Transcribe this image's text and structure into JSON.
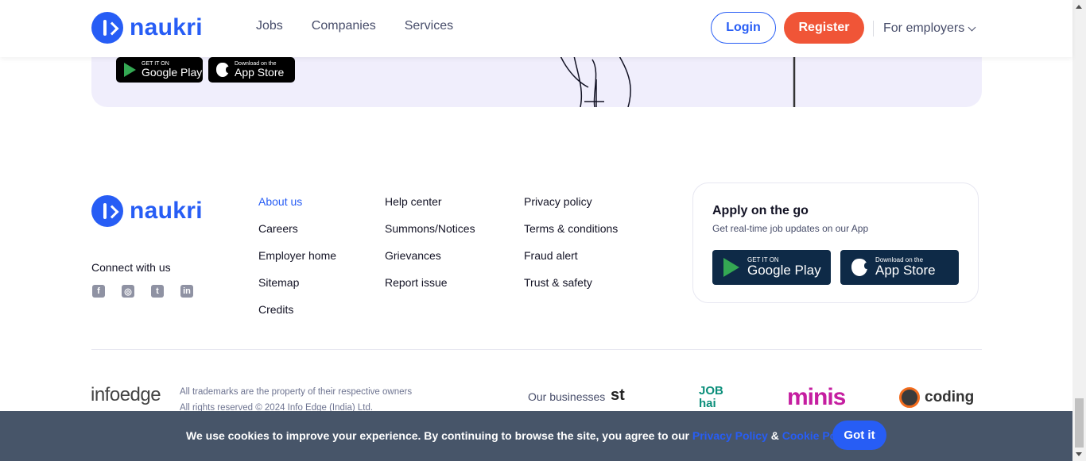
{
  "header": {
    "brand": "naukri",
    "nav": [
      "Jobs",
      "Companies",
      "Services"
    ],
    "login": "Login",
    "register": "Register",
    "employers": "For employers"
  },
  "banner": {
    "google_small": "GET IT ON",
    "google_big": "Google Play",
    "apple_small": "Download on the",
    "apple_big": "App Store"
  },
  "footer": {
    "brand": "naukri",
    "connect": "Connect with us",
    "social": [
      "f",
      "◎",
      "t",
      "in"
    ],
    "col1": [
      "About us",
      "Careers",
      "Employer home",
      "Sitemap",
      "Credits"
    ],
    "col2": [
      "Help center",
      "Summons/Notices",
      "Grievances",
      "Report issue"
    ],
    "col3": [
      "Privacy policy",
      "Terms & conditions",
      "Fraud alert",
      "Trust & safety"
    ],
    "app": {
      "title": "Apply on the go",
      "subtitle": "Get real-time job updates on our App",
      "google_small": "GET IT ON",
      "google_big": "Google Play",
      "apple_small": "Download on the",
      "apple_big": "App Store"
    },
    "infoedge": "infoedge",
    "legal1": "All trademarks are the property of their respective owners",
    "legal2": "All rights reserved © 2024 Info Edge (India) Ltd.",
    "our_businesses": "Our businesses",
    "biz": [
      "st",
      "JOB hai",
      "minis",
      "coding"
    ]
  },
  "cookie": {
    "text": "We use cookies to improve your experience. By continuing to browse the site, you agree to our",
    "privacy": "Privacy Policy",
    "amp": "&",
    "cookie_policy": "Cookie Policy",
    "button": "Got it"
  }
}
